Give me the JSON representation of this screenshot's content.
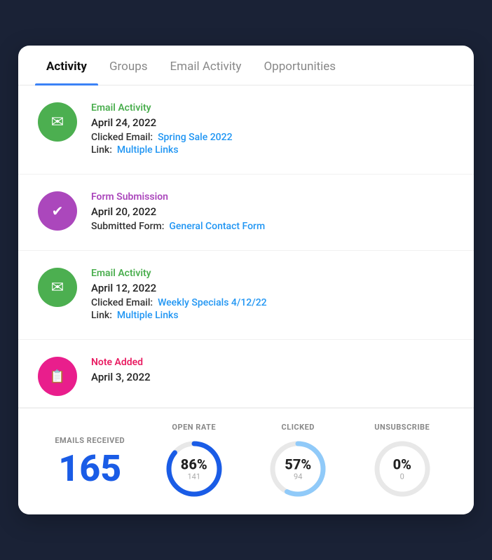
{
  "tabs": [
    {
      "label": "Activity",
      "active": true
    },
    {
      "label": "Groups",
      "active": false
    },
    {
      "label": "Email Activity",
      "active": false
    },
    {
      "label": "Opportunities",
      "active": false
    }
  ],
  "activities": [
    {
      "type": "Email Activity",
      "type_color": "green",
      "icon": "✉",
      "icon_bg": "green",
      "date": "April 24, 2022",
      "details": [
        {
          "label": "Clicked Email:",
          "value": "Spring Sale 2022"
        },
        {
          "label": "Link:",
          "value": "Multiple Links"
        }
      ]
    },
    {
      "type": "Form Submission",
      "type_color": "purple",
      "icon": "✔",
      "icon_bg": "purple",
      "date": "April 20, 2022",
      "details": [
        {
          "label": "Submitted Form:",
          "value": "General Contact Form"
        }
      ]
    },
    {
      "type": "Email Activity",
      "type_color": "green",
      "icon": "✉",
      "icon_bg": "green",
      "date": "April 12, 2022",
      "details": [
        {
          "label": "Clicked Email:",
          "value": "Weekly Specials 4/12/22"
        },
        {
          "label": "Link:",
          "value": "Multiple Links"
        }
      ]
    },
    {
      "type": "Note Added",
      "type_color": "pink",
      "icon": "📋",
      "icon_bg": "pink",
      "date": "April 3, 2022",
      "details": []
    }
  ],
  "stats": {
    "emails_received_label": "EMAILS RECEIVED",
    "emails_received_value": "165",
    "open_rate_label": "OPEN RATE",
    "open_rate_pct": "86%",
    "open_rate_sub": "141",
    "open_rate_value": 86,
    "open_rate_color": "#1a5ce6",
    "clicked_label": "CLICKED",
    "clicked_pct": "57%",
    "clicked_sub": "94",
    "clicked_value": 57,
    "clicked_color": "#90caf9",
    "unsubscribe_label": "UNSUBSCRIBE",
    "unsubscribe_pct": "0%",
    "unsubscribe_sub": "0",
    "unsubscribe_value": 0,
    "unsubscribe_color": "#e0e0e0"
  }
}
